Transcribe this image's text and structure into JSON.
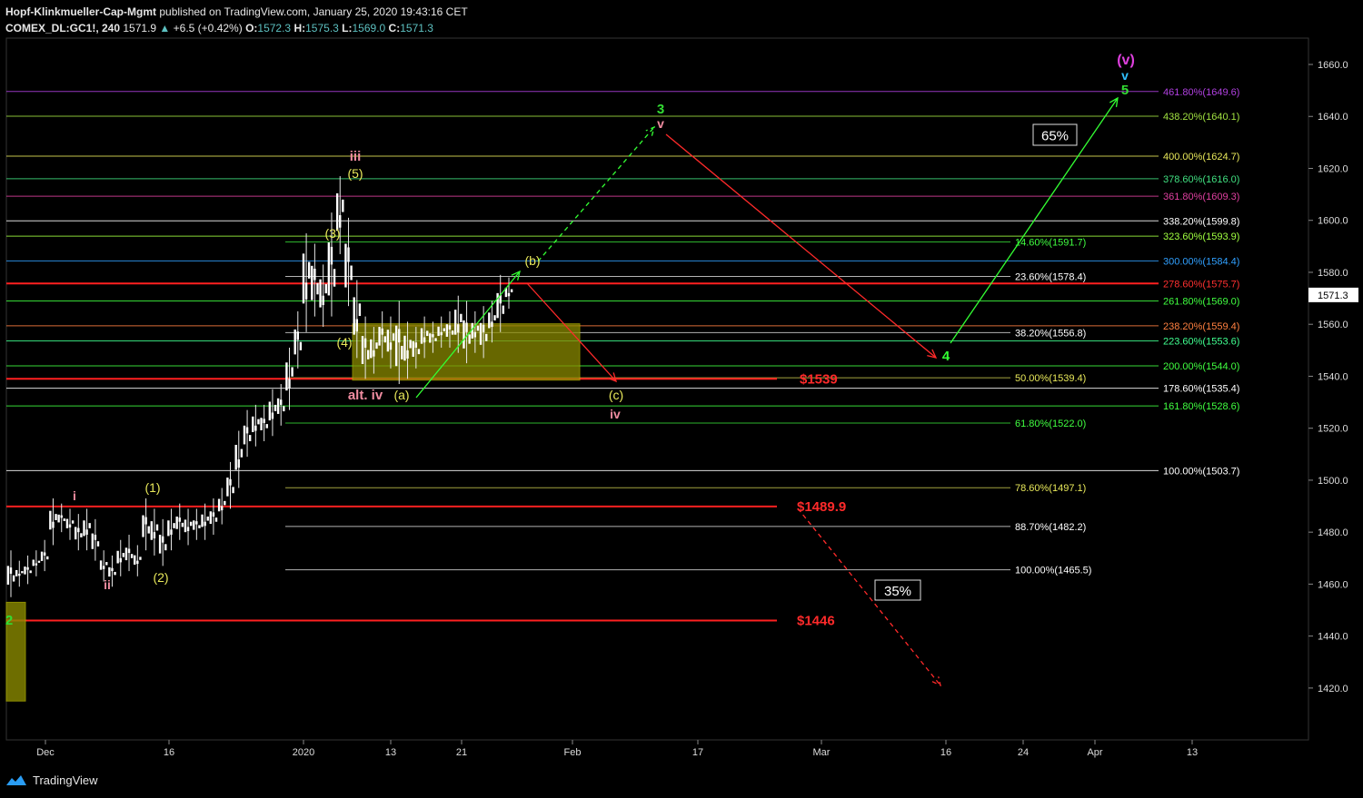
{
  "header": {
    "publisher": "Hopf-Klinkmueller-Cap-Mgmt",
    "published_text": "published on TradingView.com, January 25, 2020 19:43:16 CET",
    "symbol": "COMEX_DL:GC1!, 240",
    "last": "1571.9",
    "change": "+6.5 (+0.42%)",
    "o_label": "O:",
    "o": "1572.3",
    "h_label": "H:",
    "h": "1575.3",
    "l_label": "L:",
    "l": "1569.0",
    "c_label": "C:",
    "c": "1571.3"
  },
  "footer": {
    "brand": "TradingView"
  },
  "colors": {
    "bg": "#000000",
    "red": "#ff2a2a",
    "green": "#33ff33",
    "yellow": "#e8e85a",
    "magenta": "#e040e0",
    "cyan": "#30c0ff",
    "pink": "#f08ca0",
    "box": "#8a8a00"
  },
  "chart_data": {
    "type": "candlestick",
    "ylim": [
      1405,
      1670
    ],
    "y_ticks": [
      "1660.0",
      "1640.0",
      "1620.0",
      "1600.0",
      "1580.0",
      "1560.0",
      "1540.0",
      "1520.0",
      "1500.0",
      "1480.0",
      "1460.0",
      "1440.0",
      "1420.0"
    ],
    "x_ticks": [
      "Dec",
      "16",
      "2020",
      "13",
      "21",
      "Feb",
      "17",
      "Mar",
      "16",
      "24",
      "Apr",
      "13"
    ],
    "last_price_label": "1571.3",
    "price_path": [
      [
        1458,
        1470
      ],
      [
        1462,
        1466
      ],
      [
        1463,
        1468
      ],
      [
        1466,
        1470
      ],
      [
        1468,
        1474
      ],
      [
        1478,
        1490
      ],
      [
        1483,
        1488
      ],
      [
        1480,
        1486
      ],
      [
        1476,
        1484
      ],
      [
        1476,
        1486
      ],
      [
        1472,
        1482
      ],
      [
        1464,
        1470
      ],
      [
        1462,
        1468
      ],
      [
        1466,
        1474
      ],
      [
        1468,
        1476
      ],
      [
        1466,
        1472
      ],
      [
        1476,
        1490
      ],
      [
        1474,
        1486
      ],
      [
        1470,
        1482
      ],
      [
        1476,
        1486
      ],
      [
        1480,
        1488
      ],
      [
        1478,
        1486
      ],
      [
        1480,
        1486
      ],
      [
        1480,
        1488
      ],
      [
        1482,
        1490
      ],
      [
        1486,
        1494
      ],
      [
        1492,
        1504
      ],
      [
        1500,
        1516
      ],
      [
        1512,
        1524
      ],
      [
        1516,
        1526
      ],
      [
        1518,
        1526
      ],
      [
        1520,
        1532
      ],
      [
        1524,
        1534
      ],
      [
        1530,
        1548
      ],
      [
        1546,
        1562
      ],
      [
        1560,
        1592
      ],
      [
        1566,
        1588
      ],
      [
        1562,
        1580
      ],
      [
        1566,
        1600
      ],
      [
        1590,
        1614
      ],
      [
        1570,
        1598
      ],
      [
        1550,
        1574
      ],
      [
        1542,
        1560
      ],
      [
        1544,
        1556
      ],
      [
        1550,
        1562
      ],
      [
        1546,
        1560
      ],
      [
        1540,
        1566
      ],
      [
        1542,
        1558
      ],
      [
        1546,
        1556
      ],
      [
        1550,
        1560
      ],
      [
        1552,
        1558
      ],
      [
        1554,
        1560
      ],
      [
        1554,
        1562
      ],
      [
        1552,
        1568
      ],
      [
        1548,
        1566
      ],
      [
        1552,
        1562
      ],
      [
        1550,
        1564
      ],
      [
        1556,
        1566
      ],
      [
        1560,
        1576
      ],
      [
        1569,
        1575
      ]
    ],
    "fib_levels_right": [
      {
        "label": "461.80%(1649.6)",
        "price": 1649.6,
        "color": "#b040e0"
      },
      {
        "label": "438.20%(1640.1)",
        "price": 1640.1,
        "color": "#a0e040"
      },
      {
        "label": "400.00%(1624.7)",
        "price": 1624.7,
        "color": "#e8e85a"
      },
      {
        "label": "378.60%(1616.0)",
        "price": 1616.0,
        "color": "#40e080"
      },
      {
        "label": "361.80%(1609.3)",
        "price": 1609.3,
        "color": "#e040a0"
      },
      {
        "label": "338.20%(1599.8)",
        "price": 1599.8,
        "color": "#ffffff"
      },
      {
        "label": "323.60%(1593.9)",
        "price": 1593.9,
        "color": "#a0ff40"
      },
      {
        "label": "300.00%(1584.4)",
        "price": 1584.4,
        "color": "#30a0ff"
      },
      {
        "label": "278.60%(1575.7)",
        "price": 1575.7,
        "color": "#ff3030"
      },
      {
        "label": "261.80%(1569.0)",
        "price": 1569.0,
        "color": "#40ff40"
      },
      {
        "label": "238.20%(1559.4)",
        "price": 1559.4,
        "color": "#ff8040"
      },
      {
        "label": "223.60%(1553.6)",
        "price": 1553.6,
        "color": "#40ff90"
      },
      {
        "label": "200.00%(1544.0)",
        "price": 1544.0,
        "color": "#40ff40"
      },
      {
        "label": "178.60%(1535.4)",
        "price": 1535.4,
        "color": "#ffffff"
      },
      {
        "label": "161.80%(1528.6)",
        "price": 1528.6,
        "color": "#40ff40"
      },
      {
        "label": "100.00%(1503.7)",
        "price": 1503.7,
        "color": "#ffffff"
      }
    ],
    "fib_levels_mid": [
      {
        "label": "14.60%(1591.7)",
        "price": 1591.7,
        "color": "#40ff40"
      },
      {
        "label": "23.60%(1578.4)",
        "price": 1578.4,
        "color": "#ffffff"
      },
      {
        "label": "38.20%(1556.8)",
        "price": 1556.8,
        "color": "#ffffff"
      },
      {
        "label": "50.00%(1539.4)",
        "price": 1539.4,
        "color": "#e8e85a"
      },
      {
        "label": "61.80%(1522.0)",
        "price": 1522.0,
        "color": "#40ff40"
      },
      {
        "label": "78.60%(1497.1)",
        "price": 1497.1,
        "color": "#e8e85a"
      },
      {
        "label": "88.70%(1482.2)",
        "price": 1482.2,
        "color": "#ffffff"
      },
      {
        "label": "100.00%(1465.5)",
        "price": 1465.5,
        "color": "#ffffff"
      }
    ],
    "support_levels": [
      {
        "label": "$1539",
        "price": 1539
      },
      {
        "label": "$1489.9",
        "price": 1489.9
      },
      {
        "label": "$1446",
        "price": 1446
      }
    ],
    "wave_labels": [
      {
        "text": "i",
        "color": "#f08ca0"
      },
      {
        "text": "ii",
        "color": "#f08ca0"
      },
      {
        "text": "(1)",
        "color": "#e8e85a"
      },
      {
        "text": "(2)",
        "color": "#e8e85a"
      },
      {
        "text": "(3)",
        "color": "#e8e85a"
      },
      {
        "text": "(4)",
        "color": "#e8e85a"
      },
      {
        "text": "(5)",
        "color": "#e8e85a"
      },
      {
        "text": "iii",
        "color": "#f08ca0"
      },
      {
        "text": "alt. iv",
        "color": "#f08ca0"
      },
      {
        "text": "(a)",
        "color": "#e8e85a"
      },
      {
        "text": "(b)",
        "color": "#e8e85a"
      },
      {
        "text": "(c)",
        "color": "#e8e85a"
      },
      {
        "text": "iv",
        "color": "#f08ca0"
      },
      {
        "text": "3",
        "color": "#33dd33"
      },
      {
        "text": "v",
        "color": "#f08ca0"
      },
      {
        "text": "4",
        "color": "#33ff33"
      },
      {
        "text": "(v)",
        "color": "#e040e0"
      },
      {
        "text": "v",
        "color": "#30c0ff"
      },
      {
        "text": "5",
        "color": "#33dd33"
      },
      {
        "text": "2",
        "color": "#33dd33"
      }
    ],
    "probabilities": [
      "65%",
      "35%"
    ]
  }
}
